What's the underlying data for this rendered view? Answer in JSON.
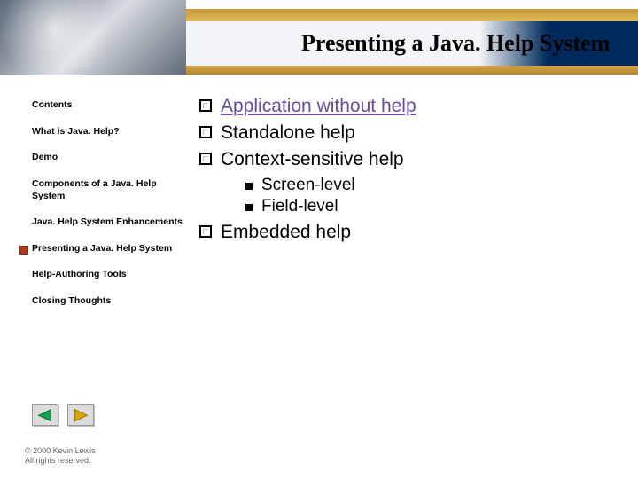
{
  "header": {
    "title": "Presenting a Java. Help System"
  },
  "sidebar": {
    "items": [
      {
        "label": "Contents",
        "active": false
      },
      {
        "label": "What is Java. Help?",
        "active": false
      },
      {
        "label": "Demo",
        "active": false
      },
      {
        "label": "Components of a Java. Help System",
        "active": false
      },
      {
        "label": "Java. Help System Enhancements",
        "active": false
      },
      {
        "label": "Presenting a Java. Help System",
        "active": true
      },
      {
        "label": "Help-Authoring Tools",
        "active": false
      },
      {
        "label": "Closing Thoughts",
        "active": false
      }
    ]
  },
  "content": {
    "bullets": [
      {
        "text": "Application without help",
        "link": true,
        "sub": []
      },
      {
        "text": "Standalone help",
        "link": false,
        "sub": []
      },
      {
        "text": "Context-sensitive help",
        "link": false,
        "sub": [
          {
            "text": "Screen-level"
          },
          {
            "text": "Field-level"
          }
        ]
      },
      {
        "text": "Embedded help",
        "link": false,
        "sub": []
      }
    ]
  },
  "footer": {
    "line1": "© 2000 Kevin Lewis",
    "line2": "All rights reserved."
  },
  "icons": {
    "prev_color": "#15a24a",
    "next_color": "#d8a400"
  }
}
